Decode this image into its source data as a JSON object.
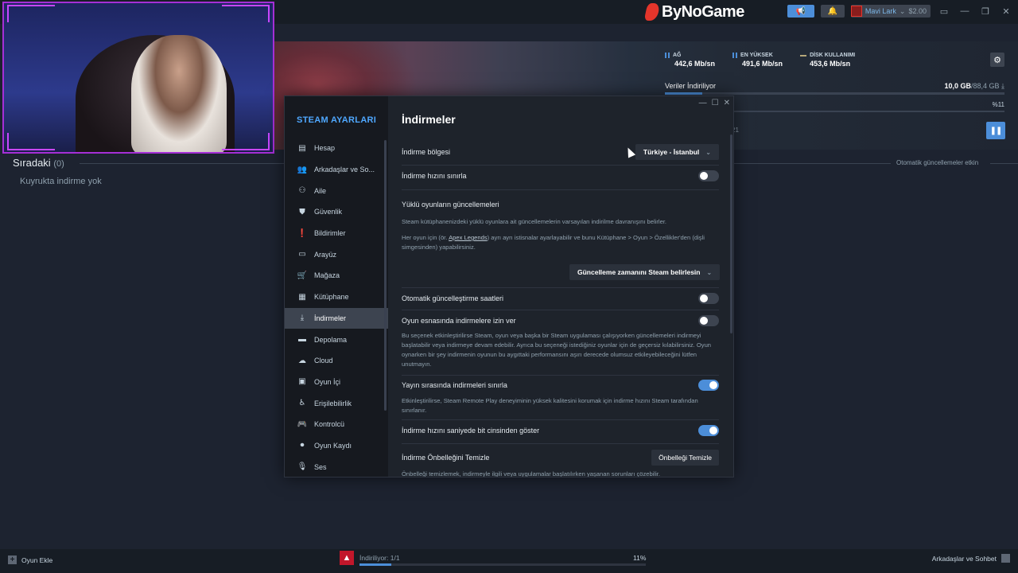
{
  "brand": {
    "name": "ByNoGame"
  },
  "topbar": {
    "user_name": "Mavi Lark",
    "balance": "$2.00"
  },
  "stats": [
    {
      "label": "AĞ",
      "value": "442,6 Mb/sn"
    },
    {
      "label": "EN YÜKSEK",
      "value": "491,6 Mb/sn"
    },
    {
      "label": "DİSK KULLANIMI",
      "value": "453,6 Mb/sn"
    }
  ],
  "download": {
    "status": "Veriler İndiriliyor",
    "downloaded": "10,0 GB",
    "total": "/88,4 GB",
    "percent_label": "%11",
    "progress": 0.11,
    "hero_partial": "21"
  },
  "queue": {
    "title": "Sıradaki",
    "count": "(0)",
    "empty_text": "Kuyrukta indirme yok",
    "auto_updates": "Otomatik güncellemeler etkin"
  },
  "settings": {
    "sidebar_title": "STEAM AYARLARI",
    "items": [
      {
        "label": "Hesap",
        "icon": "id-card-icon",
        "glyph": "▤"
      },
      {
        "label": "Arkadaşlar ve So...",
        "icon": "friends-icon",
        "glyph": "👥"
      },
      {
        "label": "Aile",
        "icon": "family-icon",
        "glyph": "⚇"
      },
      {
        "label": "Güvenlik",
        "icon": "shield-icon",
        "glyph": "⛊"
      },
      {
        "label": "Bildirimler",
        "icon": "alert-icon",
        "glyph": "❗"
      },
      {
        "label": "Arayüz",
        "icon": "monitor-icon",
        "glyph": "▭"
      },
      {
        "label": "Mağaza",
        "icon": "cart-icon",
        "glyph": "🛒"
      },
      {
        "label": "Kütüphane",
        "icon": "grid-icon",
        "glyph": "▦"
      },
      {
        "label": "İndirmeler",
        "icon": "download-icon",
        "glyph": "⤓",
        "active": true
      },
      {
        "label": "Depolama",
        "icon": "drive-icon",
        "glyph": "▬"
      },
      {
        "label": "Cloud",
        "icon": "cloud-icon",
        "glyph": "☁"
      },
      {
        "label": "Oyun İçi",
        "icon": "overlay-icon",
        "glyph": "▣"
      },
      {
        "label": "Erişilebilirlik",
        "icon": "accessibility-icon",
        "glyph": "♿"
      },
      {
        "label": "Kontrolcü",
        "icon": "gamepad-icon",
        "glyph": "🎮"
      },
      {
        "label": "Oyun Kaydı",
        "icon": "record-icon",
        "glyph": "⏺"
      },
      {
        "label": "Ses",
        "icon": "mic-icon",
        "glyph": "🎙"
      }
    ],
    "page_title": "İndirmeler",
    "region_label": "İndirme bölgesi",
    "region_value": "Türkiye - İstanbul",
    "limit_speed_label": "İndirme hızını sınırla",
    "limit_speed_on": false,
    "updates_heading": "Yüklü oyunların güncellemeleri",
    "updates_desc1": "Steam kütüphanenizdeki yüklü oyunlara ait güncellemelerin varsayılan indirilme davranışını belirler.",
    "updates_desc2_pre": "Her oyun için (ör. ",
    "updates_desc2_link": "Apex Legends",
    "updates_desc2_post": ") ayrı ayrı istisnalar ayarlayabilir ve bunu Kütüphane > Oyun > Özellikler'den (dişli simgesinden) yapabilirsiniz.",
    "update_timing_value": "Güncelleme zamanını Steam belirlesin",
    "auto_update_hours_label": "Otomatik güncelleştirme saatleri",
    "auto_update_hours_on": false,
    "allow_during_game_label": "Oyun esnasında indirmelere izin ver",
    "allow_during_game_on": false,
    "allow_during_game_desc": "Bu seçenek etkinleştirilirse Steam, oyun veya başka bir Steam uygulaması çalışıyorken güncellemeleri indirmeyi başlatabilir veya indirmeye devam edebilir. Ayrıca bu seçeneği istediğiniz oyunlar için de geçersiz kılabilirsiniz. Oyun oynarken bir şey indirmenin oyunun bu aygıttaki performansını aşırı derecede olumsuz etkileyebileceğini lütfen unutmayın.",
    "throttle_stream_label": "Yayın sırasında indirmeleri sınırla",
    "throttle_stream_on": true,
    "throttle_stream_desc": "Etkinleştirilirse, Steam Remote Play deneyiminin yüksek kalitesini korumak için indirme hızını Steam tarafından sınırlanır.",
    "bits_label": "İndirme hızını saniyede bit cinsinden göster",
    "bits_on": true,
    "clear_cache_label": "İndirme Önbelleğini Temizle",
    "clear_cache_button": "Önbelleği Temizle",
    "clear_cache_desc": "Önbelleği temizlemek, indirmeyle ilgili veya uygulamalar başlatılırken yaşanan sorunları çözebilir."
  },
  "bottombar": {
    "add_game": "Oyun Ekle",
    "downloading_label": "İndiriliyor:",
    "downloading_count": "1/1",
    "percent": "11%",
    "progress": 0.11,
    "friends": "Arkadaşlar ve Sohbet"
  },
  "colors": {
    "accent": "#4c8ed9",
    "sidebar_title": "#4fa8ff",
    "webcam_border": "#a52fd6",
    "brand_red": "#e4352b"
  }
}
